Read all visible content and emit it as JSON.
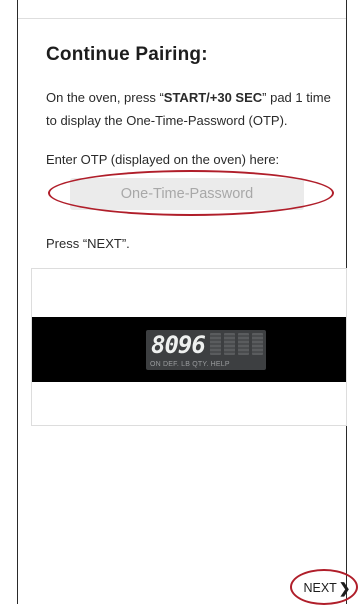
{
  "header": {
    "title": "Continue Pairing:"
  },
  "instructions": {
    "prefix": "On the oven, press “",
    "bold": "START/+30 SEC",
    "suffix": "” pad 1 time to display the One-Time-Password (OTP)."
  },
  "otp": {
    "label": "Enter OTP (displayed on the oven) here:",
    "value": "",
    "placeholder": "One-Time-Password"
  },
  "press_next": "Press “NEXT”.",
  "oven_display": {
    "digits": "8096",
    "modes": "ON DEF. LB QTY. HELP"
  },
  "footer": {
    "next_label": "NEXT",
    "next_icon": "chevron-right-icon"
  },
  "colors": {
    "highlight": "#b01e2a",
    "input_bg": "#ebebeb",
    "display_bg": "#3d3f41"
  }
}
